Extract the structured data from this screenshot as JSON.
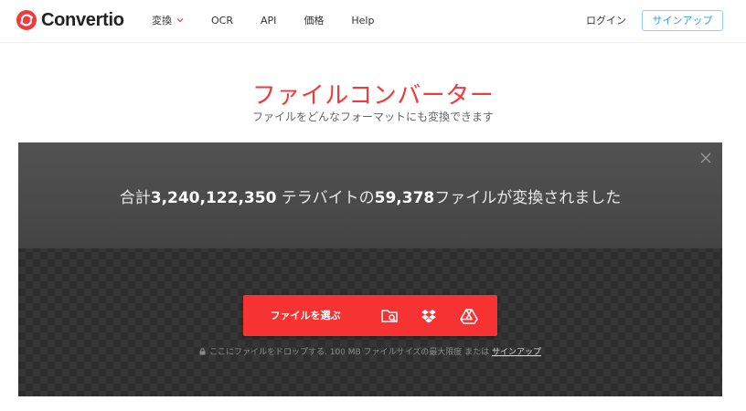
{
  "header": {
    "logo_text": "Convertio",
    "nav": [
      {
        "label": "変換",
        "has_dropdown": true
      },
      {
        "label": "OCR"
      },
      {
        "label": "API"
      },
      {
        "label": "価格"
      },
      {
        "label": "Help"
      }
    ],
    "login_label": "ログイン",
    "signup_label": "サインアップ"
  },
  "hero": {
    "title": "ファイルコンバーター",
    "subtitle": "ファイルをどんなフォーマットにも変換できます"
  },
  "stats": {
    "prefix": "合計",
    "terabytes": "3,240,122,350",
    "middle": " テラバイトの",
    "files": "59,378",
    "suffix": "ファイルが変換されました"
  },
  "upload": {
    "choose_label": "ファイルを選ぶ",
    "sources": [
      {
        "icon": "folder-search-icon"
      },
      {
        "icon": "dropbox-icon"
      },
      {
        "icon": "google-drive-icon"
      }
    ],
    "drop_note": "ここにファイルをドロップする. 100 MB ファイルサイズの最大限度 または ",
    "signup_link": "サインアップ"
  },
  "colors": {
    "brand_red": "#f33a3a",
    "button_red": "#f73232",
    "signup_blue": "#33a3de"
  }
}
